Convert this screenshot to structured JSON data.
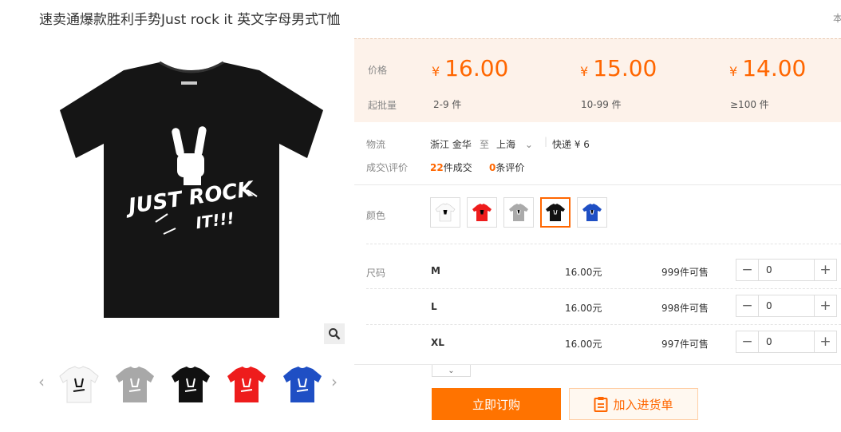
{
  "product": {
    "title": "速卖通爆款胜利手势Just rock it 英文字母男式T恤",
    "title_right": "本"
  },
  "gallery": {
    "main_color": "black",
    "thumbnails": [
      {
        "color": "#ffffff",
        "label": "white"
      },
      {
        "color": "#aaaaaa",
        "label": "gray"
      },
      {
        "color": "#111111",
        "label": "black"
      },
      {
        "color": "#ee1c1c",
        "label": "red"
      },
      {
        "color": "#1f4fc4",
        "label": "blue"
      }
    ]
  },
  "pricing": {
    "price_label": "价格",
    "min_qty_label": "起批量",
    "currency": "¥",
    "tiers": [
      {
        "price": "16.00",
        "range": "2-9 件"
      },
      {
        "price": "15.00",
        "range": "10-99 件"
      },
      {
        "price": "14.00",
        "range": "≥100 件"
      }
    ]
  },
  "logistics": {
    "label": "物流",
    "from": "浙江 金华",
    "to_word": "至",
    "to": "上海",
    "shipping": "快递 ¥ 6"
  },
  "sales": {
    "label": "成交\\评价",
    "deals_count": "22",
    "deals_text": "件成交",
    "reviews_count": "0",
    "reviews_text": "条评价"
  },
  "color": {
    "label": "颜色",
    "options": [
      {
        "color": "#ffffff",
        "selected": false
      },
      {
        "color": "#ee1c1c",
        "selected": false
      },
      {
        "color": "#aaaaaa",
        "selected": false
      },
      {
        "color": "#111111",
        "selected": true
      },
      {
        "color": "#1f4fc4",
        "selected": false
      }
    ]
  },
  "sizes": {
    "label": "尺码",
    "rows": [
      {
        "name": "M",
        "price": "16.00元",
        "stock": "999件可售",
        "qty": "0"
      },
      {
        "name": "L",
        "price": "16.00元",
        "stock": "998件可售",
        "qty": "0"
      },
      {
        "name": "XL",
        "price": "16.00元",
        "stock": "997件可售",
        "qty": "0"
      }
    ]
  },
  "actions": {
    "buy_label": "立即订购",
    "cart_label": "加入进货单"
  },
  "colors": {
    "accent": "#ff6600",
    "price_bg": "#fdf2ea"
  }
}
